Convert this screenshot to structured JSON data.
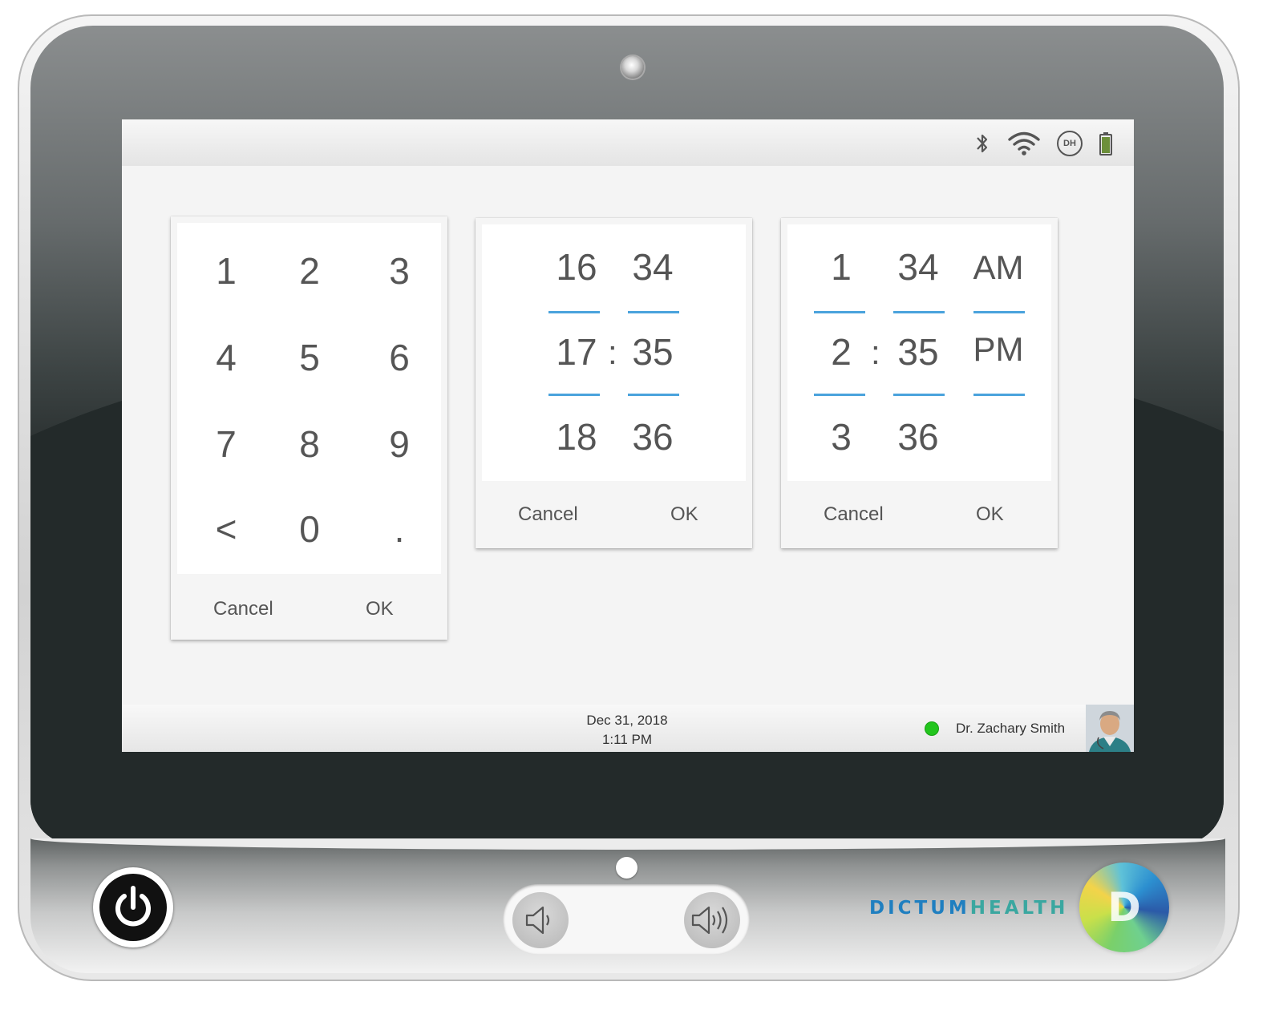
{
  "status_bar": {
    "icons": [
      "bluetooth-icon",
      "wifi-icon",
      "dh-icon",
      "battery-icon"
    ],
    "dh_badge": "DH"
  },
  "numpad": {
    "keys": [
      "1",
      "2",
      "3",
      "4",
      "5",
      "6",
      "7",
      "8",
      "9",
      "<",
      "0",
      "."
    ],
    "cancel_label": "Cancel",
    "ok_label": "OK"
  },
  "time_picker_24h": {
    "hours": [
      "16",
      "17",
      "18"
    ],
    "minutes": [
      "34",
      "35",
      "36"
    ],
    "separator": ":",
    "cancel_label": "Cancel",
    "ok_label": "OK"
  },
  "time_picker_12h": {
    "hours": [
      "1",
      "2",
      "3"
    ],
    "minutes": [
      "34",
      "35",
      "36"
    ],
    "periods": [
      "AM",
      "PM"
    ],
    "separator": ":",
    "cancel_label": "Cancel",
    "ok_label": "OK"
  },
  "footer": {
    "date": "Dec 31, 2018",
    "time": "1:11 PM",
    "user_name": "Dr. Zachary Smith",
    "user_status_color": "#22c51d"
  },
  "brand": {
    "name_part1": "DICTUM",
    "name_part2": "HEALTH",
    "logo_letter": "D",
    "primary_color": "#1f7fc0",
    "secondary_color": "#3aa7a0"
  },
  "colors": {
    "accent_line": "#4aa3dc",
    "screen_background": "#f4f4f4"
  }
}
